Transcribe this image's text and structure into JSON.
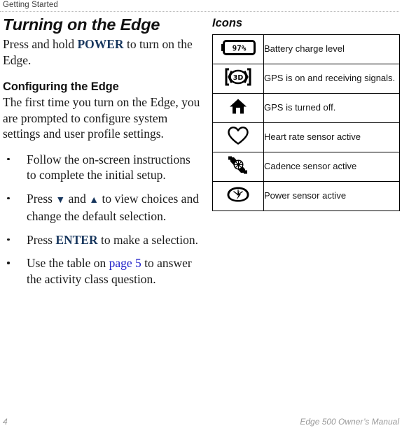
{
  "header": {
    "title": "Getting Started"
  },
  "left_column": {
    "section_title": "Turning on the Edge",
    "intro_before_key": "Press and hold ",
    "intro_key": "POWER",
    "intro_after_key": " to turn on the Edge.",
    "subsection_title": "Configuring the Edge",
    "subsection_body": "The first time you turn on the Edge, you are prompted to configure system settings and user profile settings.",
    "bullets": [
      {
        "id": "bullet-follow-instructions",
        "text": "Follow the on-screen instructions to complete the initial setup."
      },
      {
        "id": "bullet-press-arrows",
        "prefix": "Press ",
        "arrow_down": "▼",
        "middle": " and ",
        "arrow_up": "▲",
        "suffix": " to view choices and change the default selection."
      },
      {
        "id": "bullet-press-enter",
        "prefix": "Press ",
        "key": "ENTER",
        "suffix": " to make a selection."
      },
      {
        "id": "bullet-activity-class",
        "prefix": "Use the table on ",
        "xref": "page 5",
        "suffix": " to answer the activity class question."
      }
    ]
  },
  "right_column": {
    "icons_title": "Icons",
    "table_rows": [
      {
        "icon_name": "battery-charge-icon",
        "battery_percent": "97%",
        "description": "Battery charge level"
      },
      {
        "icon_name": "gps-3d-signal-icon",
        "gps_label": "3D",
        "description": "GPS is on and receiving signals."
      },
      {
        "icon_name": "gps-off-home-icon",
        "description": "GPS is turned off."
      },
      {
        "icon_name": "heart-rate-icon",
        "description": "Heart rate sensor active"
      },
      {
        "icon_name": "cadence-sensor-icon",
        "description": "Cadence sensor active"
      },
      {
        "icon_name": "power-sensor-icon",
        "description": "Power sensor active"
      }
    ]
  },
  "footer": {
    "page_number": "4",
    "manual_title": "Edge 500 Owner’s Manual"
  },
  "colors": {
    "key_term": "#17365d",
    "cross_reference": "#2020c8",
    "footer_gray": "#9a9a9a",
    "rule_gray": "#b9b9b9"
  }
}
